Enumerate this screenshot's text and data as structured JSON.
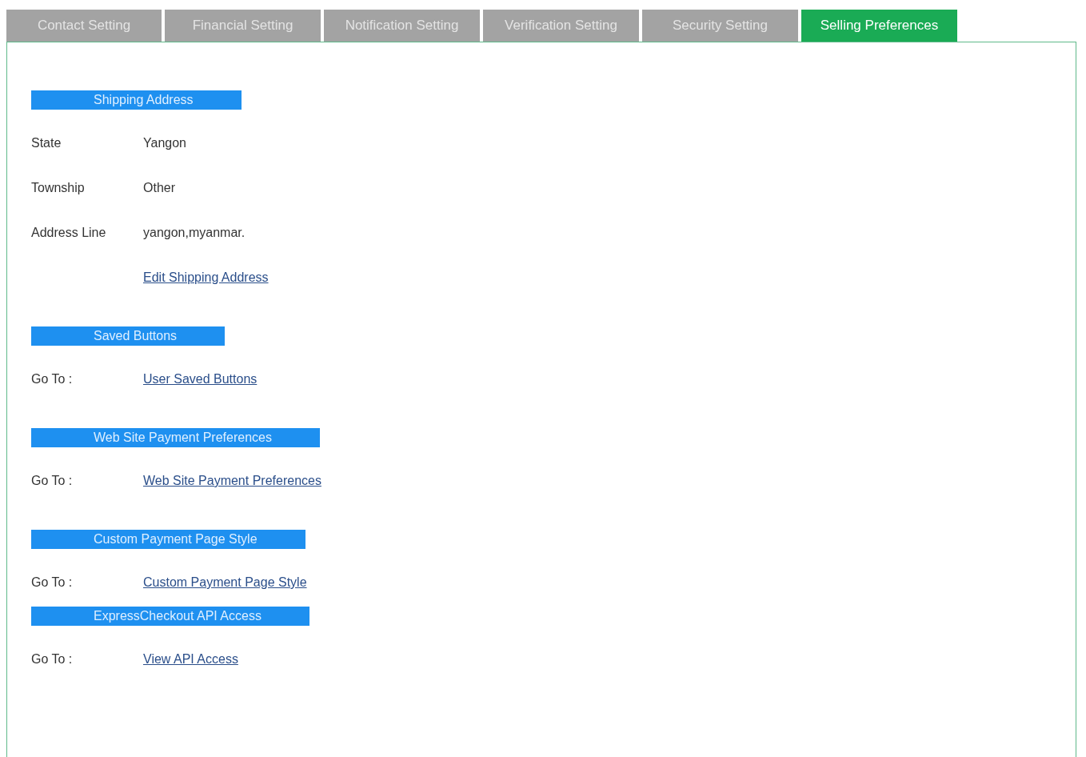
{
  "tabs": [
    {
      "label": "Contact Setting",
      "selected": false
    },
    {
      "label": "Financial Setting",
      "selected": false
    },
    {
      "label": "Notification Setting",
      "selected": false
    },
    {
      "label": "Verification Setting",
      "selected": false
    },
    {
      "label": "Security Setting",
      "selected": false
    },
    {
      "label": "Selling Preferences",
      "selected": true
    }
  ],
  "sections": [
    {
      "title": "Shipping Address",
      "rows": [
        {
          "kind": "text",
          "label": "State",
          "value": "Yangon"
        },
        {
          "kind": "text",
          "label": "Township",
          "value": "Other"
        },
        {
          "kind": "text",
          "label": "Address Line",
          "value": "yangon,myanmar."
        },
        {
          "kind": "link",
          "value": "Edit Shipping Address"
        }
      ]
    },
    {
      "title": "Saved Buttons",
      "rows": [
        {
          "kind": "link",
          "label": "Go To :",
          "value": "User Saved Buttons"
        }
      ]
    },
    {
      "title": "Web Site Payment Preferences",
      "rows": [
        {
          "kind": "link",
          "label": "Go To :",
          "value": "Web Site Payment Preferences"
        }
      ]
    },
    {
      "title": "Custom Payment Page Style",
      "rows": [
        {
          "kind": "link",
          "label": "Go To :",
          "value": "Custom Payment Page Style"
        }
      ]
    },
    {
      "title": "ExpressCheckout API Access",
      "rows": [
        {
          "kind": "link",
          "label": "Go To :",
          "value": "View API Access"
        }
      ]
    }
  ]
}
